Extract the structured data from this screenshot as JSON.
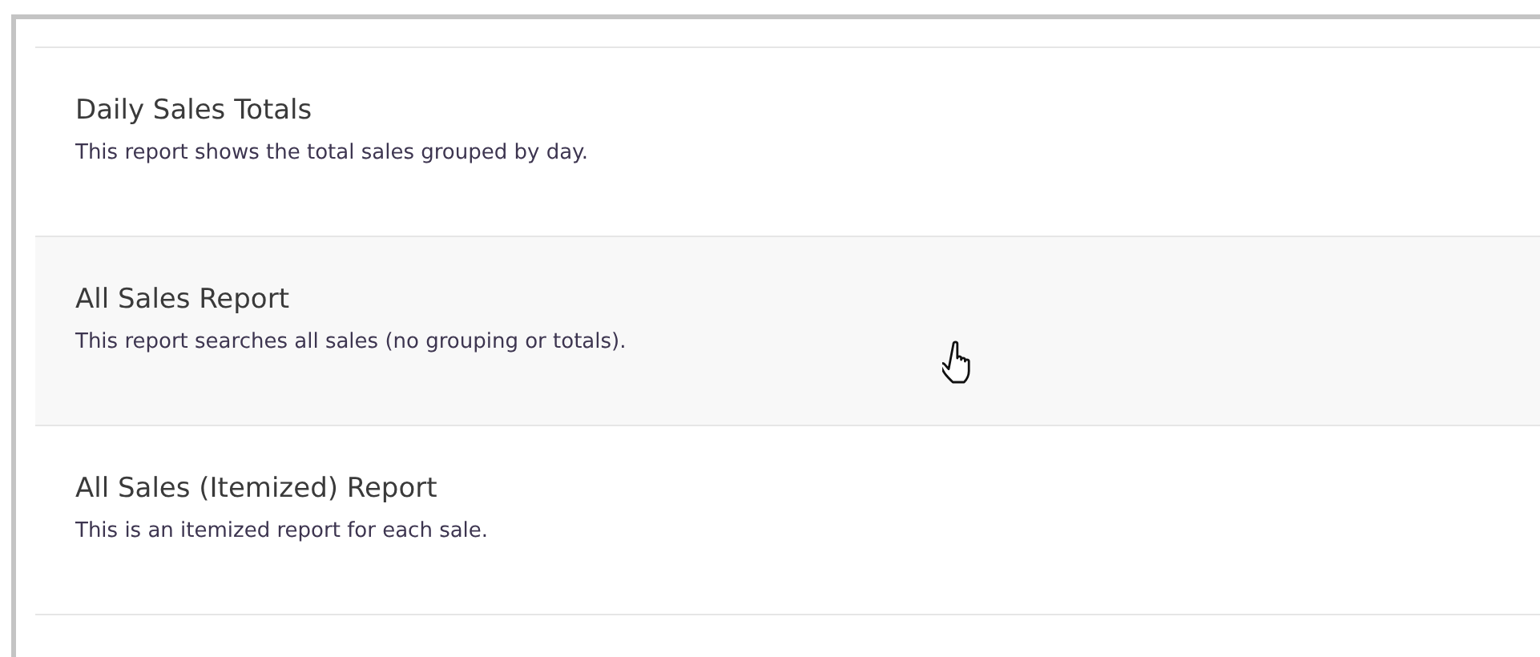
{
  "reports": [
    {
      "title": "Daily Sales Totals",
      "description": "This report shows the total sales grouped by day.",
      "hovered": false
    },
    {
      "title": "All Sales Report",
      "description": "This report searches all sales (no grouping or totals).",
      "hovered": true
    },
    {
      "title": "All Sales (Itemized) Report",
      "description": "This is an itemized report for each sale.",
      "hovered": false
    }
  ]
}
